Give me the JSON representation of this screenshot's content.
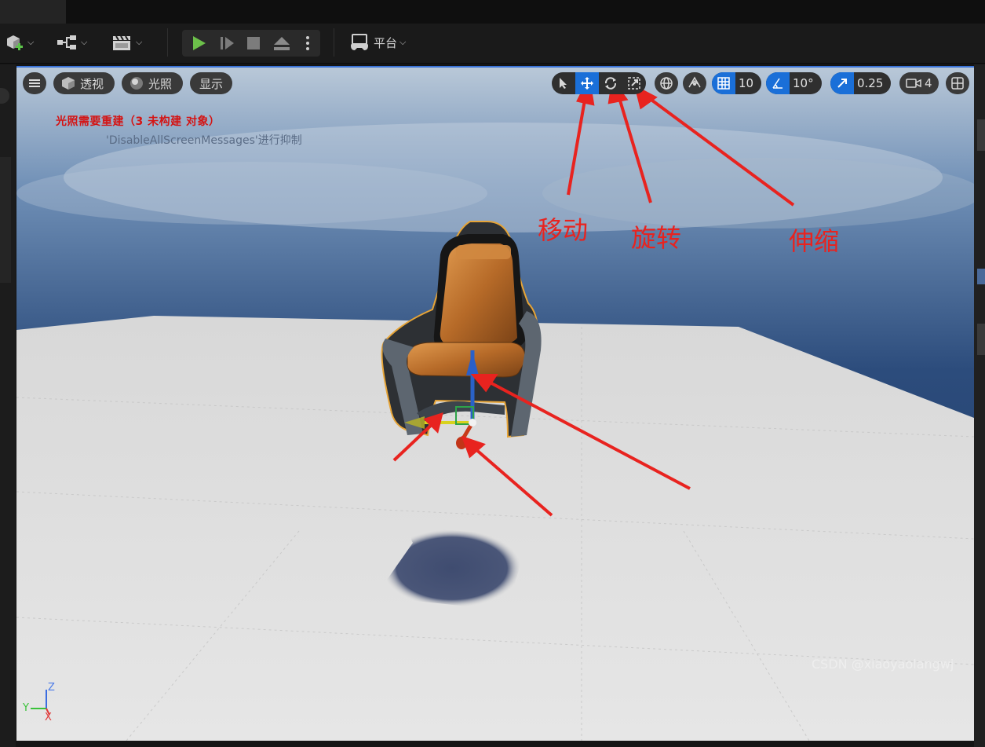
{
  "toolbar": {
    "platform_label": "平台"
  },
  "viewport": {
    "view_mode_label": "透视",
    "lighting_label": "光照",
    "show_label": "显示",
    "grid_snap_value": "10",
    "rotation_snap_value": "10°",
    "scale_snap_value": "0.25",
    "camera_speed_value": "4",
    "warning_message": "光照需要重建（3 未构建 对象）",
    "suppress_message": "'DisableAllScreenMessages'进行抑制",
    "axis_labels": {
      "z": "Z",
      "y": "Y",
      "x": "X"
    }
  },
  "annotations": {
    "move": "移动",
    "rotate": "旋转",
    "scale": "伸缩"
  },
  "watermark": "CSDN @xiaoyaolangwj",
  "colors": {
    "accent": "#1a6fd8",
    "annotation_red": "#e8231f",
    "play_green": "#6cc04a",
    "warning_red": "#d41414"
  }
}
